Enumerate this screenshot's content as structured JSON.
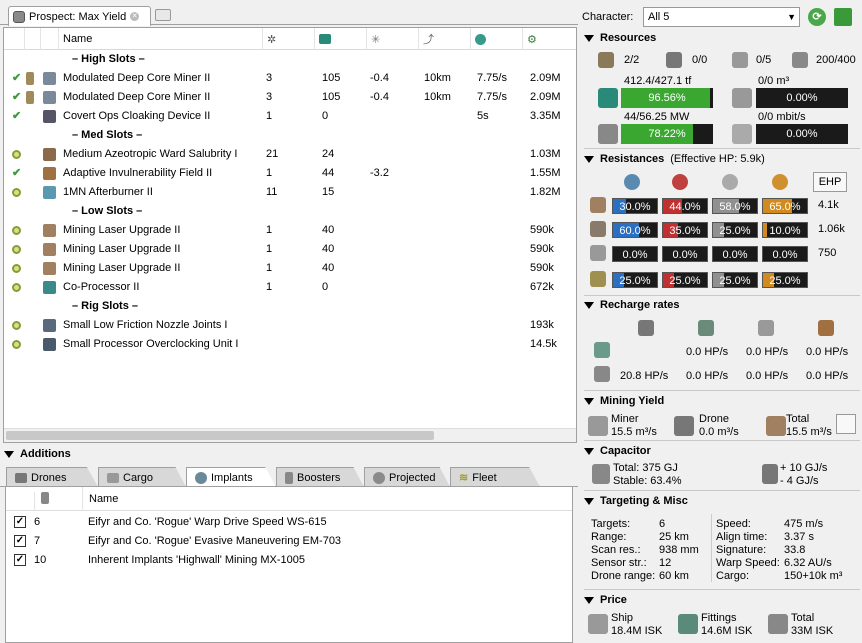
{
  "tab": {
    "title": "Prospect: Max Yield"
  },
  "fit": {
    "columns": [
      "Name"
    ],
    "sections": {
      "high": "– High Slots –",
      "med": "– Med Slots –",
      "low": "– Low Slots –",
      "rig": "– Rig Slots –"
    },
    "modules": [
      {
        "state": "active",
        "name": "Modulated Deep Core Miner II",
        "c1": "3",
        "c2": "105",
        "c3": "-0.4",
        "c4": "10km",
        "c5": "7.75/s",
        "price": "2.09M"
      },
      {
        "state": "active",
        "name": "Modulated Deep Core Miner II",
        "c1": "3",
        "c2": "105",
        "c3": "-0.4",
        "c4": "10km",
        "c5": "7.75/s",
        "price": "2.09M"
      },
      {
        "state": "active",
        "name": "Covert Ops Cloaking Device II",
        "c1": "1",
        "c2": "0",
        "c3": "",
        "c4": "",
        "c5": "5s",
        "price": "3.35M"
      },
      {
        "state": "online",
        "name": "Medium Azeotropic Ward Salubrity I",
        "c1": "21",
        "c2": "24",
        "c3": "",
        "c4": "",
        "c5": "",
        "price": "1.03M"
      },
      {
        "state": "active",
        "name": "Adaptive Invulnerability Field II",
        "c1": "1",
        "c2": "44",
        "c3": "-3.2",
        "c4": "",
        "c5": "",
        "price": "1.55M"
      },
      {
        "state": "online",
        "name": "1MN Afterburner II",
        "c1": "11",
        "c2": "15",
        "c3": "",
        "c4": "",
        "c5": "",
        "price": "1.82M"
      },
      {
        "state": "online",
        "name": "Mining Laser Upgrade II",
        "c1": "1",
        "c2": "40",
        "c3": "",
        "c4": "",
        "c5": "",
        "price": "590k"
      },
      {
        "state": "online",
        "name": "Mining Laser Upgrade II",
        "c1": "1",
        "c2": "40",
        "c3": "",
        "c4": "",
        "c5": "",
        "price": "590k"
      },
      {
        "state": "online",
        "name": "Mining Laser Upgrade II",
        "c1": "1",
        "c2": "40",
        "c3": "",
        "c4": "",
        "c5": "",
        "price": "590k"
      },
      {
        "state": "online",
        "name": "Co-Processor II",
        "c1": "1",
        "c2": "0",
        "c3": "",
        "c4": "",
        "c5": "",
        "price": "672k"
      },
      {
        "state": "online",
        "name": "Small Low Friction Nozzle Joints I",
        "c1": "",
        "c2": "",
        "c3": "",
        "c4": "",
        "c5": "",
        "price": "193k"
      },
      {
        "state": "online",
        "name": "Small Processor Overclocking Unit I",
        "c1": "",
        "c2": "",
        "c3": "",
        "c4": "",
        "c5": "",
        "price": "14.5k"
      }
    ]
  },
  "additions": {
    "title": "Additions",
    "tabs": [
      "Drones",
      "Cargo",
      "Implants",
      "Boosters",
      "Projected",
      "Fleet"
    ],
    "name_header": "Name",
    "implants": [
      {
        "slot": "6",
        "name": "Eifyr and Co. 'Rogue' Warp Drive Speed WS-615"
      },
      {
        "slot": "7",
        "name": "Eifyr and Co. 'Rogue' Evasive Maneuvering EM-703"
      },
      {
        "slot": "10",
        "name": "Inherent Implants 'Highwall' Mining MX-1005"
      }
    ]
  },
  "character": {
    "label": "Character:",
    "value": "All 5"
  },
  "resources": {
    "title": "Resources",
    "counts": [
      "2/2",
      "0/0",
      "0/5",
      "200/400"
    ],
    "cpu": {
      "text": "412.4/427.1 tf",
      "percent": "96.56%",
      "fraction": 0.9656
    },
    "powergrid": {
      "text": "44/56.25 MW",
      "percent": "78.22%",
      "fraction": 0.7822
    },
    "drone_bay": {
      "text": "0/0 m³",
      "percent": "0.00%"
    },
    "drone_bw": {
      "text": "0/0 mbit/s",
      "percent": "0.00%"
    }
  },
  "resistances": {
    "title": "Resistances",
    "ehp_note": "(Effective HP: 5.9k)",
    "ehp_button": "EHP",
    "rows": [
      {
        "vals": [
          "30.0%",
          "44.0%",
          "58.0%",
          "65.0%"
        ],
        "ehp": "4.1k"
      },
      {
        "vals": [
          "60.0%",
          "35.0%",
          "25.0%",
          "10.0%"
        ],
        "ehp": "1.06k"
      },
      {
        "vals": [
          "0.0%",
          "0.0%",
          "0.0%",
          "0.0%"
        ],
        "ehp": "750"
      },
      {
        "vals": [
          "25.0%",
          "25.0%",
          "25.0%",
          "25.0%"
        ],
        "ehp": ""
      }
    ],
    "fractions": [
      [
        0.3,
        0.44,
        0.58,
        0.65
      ],
      [
        0.6,
        0.35,
        0.25,
        0.1
      ],
      [
        0,
        0,
        0,
        0
      ],
      [
        0.25,
        0.25,
        0.25,
        0.25
      ]
    ],
    "colors": [
      "#2a6fc0",
      "#c03030",
      "#909090",
      "#d08a20"
    ]
  },
  "recharge": {
    "title": "Recharge rates",
    "row1": [
      "0.0 HP/s",
      "0.0 HP/s",
      "0.0 HP/s"
    ],
    "row2": [
      "20.8 HP/s",
      "0.0 HP/s",
      "0.0 HP/s",
      "0.0 HP/s"
    ]
  },
  "mining": {
    "title": "Mining Yield",
    "miner_label": "Miner",
    "miner_val": "15.5 m³/s",
    "drone_label": "Drone",
    "drone_val": "0.0 m³/s",
    "total_label": "Total",
    "total_val": "15.5 m³/s"
  },
  "capacitor": {
    "title": "Capacitor",
    "total": "Total: 375 GJ",
    "stable": "Stable: 63.4%",
    "plus": "+ 10 GJ/s",
    "minus": "-  4 GJ/s"
  },
  "targeting": {
    "title": "Targeting & Misc",
    "left": [
      {
        "label": "Targets:",
        "value": "6"
      },
      {
        "label": "Range:",
        "value": "25 km"
      },
      {
        "label": "Scan res.:",
        "value": "938 mm"
      },
      {
        "label": "Sensor str.:",
        "value": "12"
      },
      {
        "label": "Drone range:",
        "value": "60 km"
      }
    ],
    "right": [
      {
        "label": "Speed:",
        "value": "475 m/s"
      },
      {
        "label": "Align time:",
        "value": "3.37 s"
      },
      {
        "label": "Signature:",
        "value": "33.8"
      },
      {
        "label": "Warp Speed:",
        "value": "6.32 AU/s"
      },
      {
        "label": "Cargo:",
        "value": "150+10k m³"
      }
    ]
  },
  "price": {
    "title": "Price",
    "ship_label": "Ship",
    "ship_val": "18.4M ISK",
    "fit_label": "Fittings",
    "fit_val": "14.6M ISK",
    "total_label": "Total",
    "total_val": "33M ISK"
  }
}
